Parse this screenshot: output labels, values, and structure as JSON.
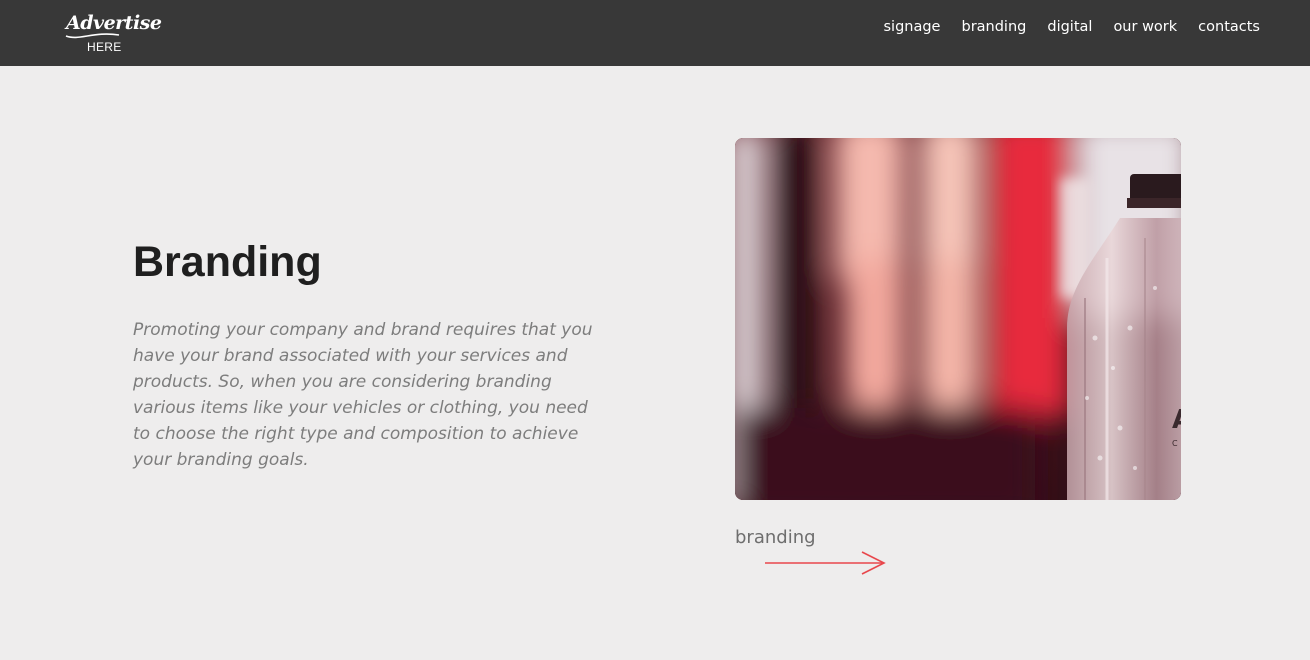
{
  "header": {
    "logo": {
      "script_text": "Advertise",
      "sub_text": "HERE"
    },
    "nav": [
      {
        "label": "signage"
      },
      {
        "label": "branding"
      },
      {
        "label": "digital"
      },
      {
        "label": "our work"
      },
      {
        "label": "contacts"
      }
    ]
  },
  "main": {
    "title": "Branding",
    "description": "Promoting your company and brand requires that you have your brand associated with your services and products. So, when you are considering branding various items like your vehicles or clothing, you need to choose the right type and composition to achieve your branding goals.",
    "image": {
      "icon": "water-bottle-photo"
    },
    "link": {
      "label": "branding",
      "icon": "arrow-right-icon"
    }
  },
  "colors": {
    "header_bg": "#383838",
    "page_bg": "#eeeded",
    "accent": "#e8474c",
    "heading": "#1f1f1f",
    "body_text": "#7d7d7d"
  }
}
